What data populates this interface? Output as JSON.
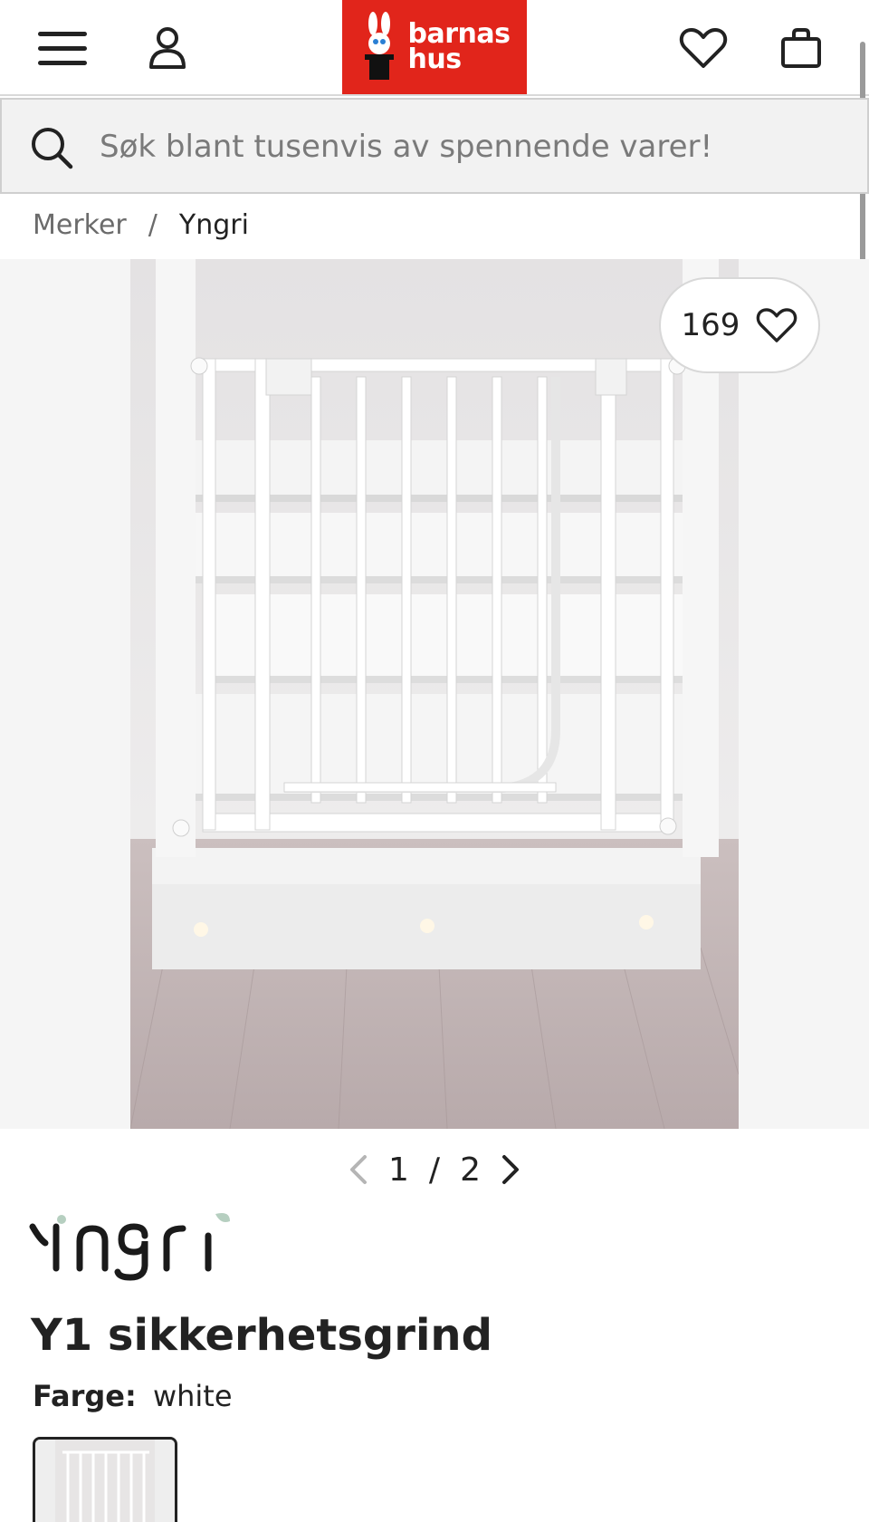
{
  "header": {
    "menu_icon": "hamburger-menu-icon",
    "account_icon": "user-icon",
    "logo_text_line1": "barnas",
    "logo_text_line2": "hus",
    "wishlist_icon": "heart-icon",
    "cart_icon": "shopping-bag-icon",
    "brand_color": "#e1251b"
  },
  "search": {
    "placeholder": "Søk blant tusenvis av spennende varer!"
  },
  "breadcrumb": {
    "items": [
      "Merker",
      "Yngri"
    ],
    "separator": "/"
  },
  "gallery": {
    "like_count": "169",
    "pager_current": "1",
    "pager_separator": "/",
    "pager_total": "2"
  },
  "product": {
    "brand_logo_text": "Yngri",
    "title": "Y1 sikkerhetsgrind",
    "color_label": "Farge:",
    "color_value": "white"
  }
}
